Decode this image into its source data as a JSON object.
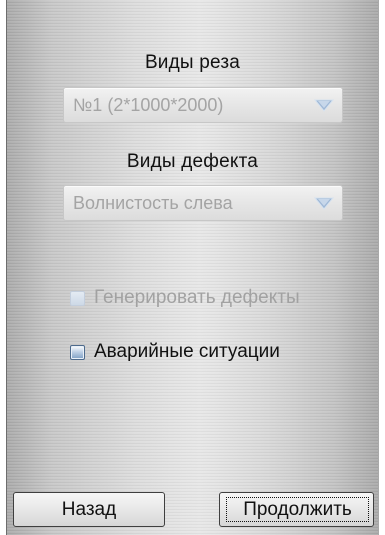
{
  "form": {
    "cut_types_label": "Виды реза",
    "cut_types_value": "№1 (2*1000*2000)",
    "defect_types_label": "Виды дефекта",
    "defect_types_value": "Волнистость слева",
    "generate_defects_label": "Генерировать дефекты",
    "emergency_situations_label": "Аварийные ситуации"
  },
  "buttons": {
    "back_label": "Назад",
    "continue_label": "Продолжить"
  },
  "state": {
    "generate_defects_checked": false,
    "generate_defects_enabled": false,
    "emergency_situations_checked": false,
    "cut_types_enabled": false,
    "defect_types_enabled": false
  },
  "icons": {
    "dropdown": "chevron-down-icon"
  },
  "colors": {
    "panel": "#dcdcdc",
    "disabled_text": "#a4a4a4",
    "text": "#111111",
    "checkbox_accent": "#7d9ec4"
  }
}
